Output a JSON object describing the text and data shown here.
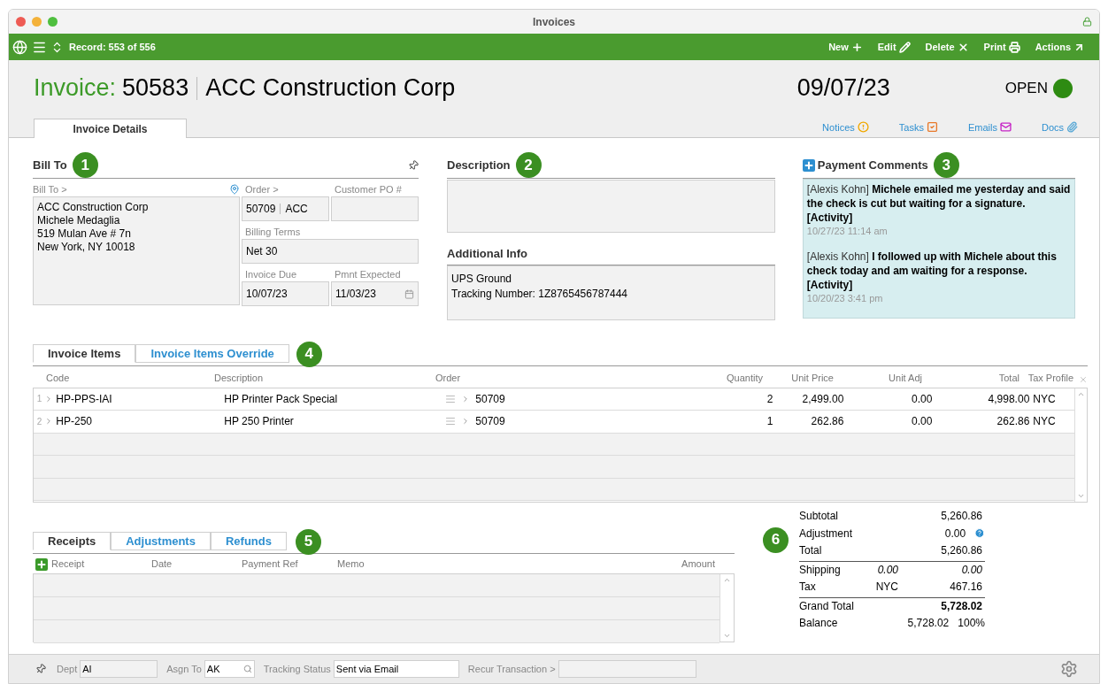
{
  "window": {
    "title": "Invoices"
  },
  "toolbar": {
    "record": "Record: 553 of 556",
    "actions": [
      {
        "label": "New",
        "kind": "plus"
      },
      {
        "label": "Edit",
        "kind": "pencil"
      },
      {
        "label": "Delete",
        "kind": "x"
      },
      {
        "label": "Print",
        "kind": "print"
      },
      {
        "label": "Actions",
        "kind": "arrow"
      }
    ]
  },
  "header": {
    "label": "Invoice:",
    "number": "50583",
    "customer": "ACC Construction Corp",
    "date": "09/07/23",
    "status": "OPEN"
  },
  "tabs": [
    {
      "label": "Invoice Details",
      "selected": true
    }
  ],
  "links": [
    {
      "label": "Notices",
      "kind": "notice"
    },
    {
      "label": "Tasks",
      "kind": "task"
    },
    {
      "label": "Emails",
      "kind": "email"
    },
    {
      "label": "Docs",
      "kind": "doc"
    }
  ],
  "bill_to": {
    "title": "Bill To",
    "callout": "1",
    "address_label": "Bill To >",
    "address_lines": [
      "ACC Construction Corp",
      "Michele Medaglia",
      "519 Mulan Ave # 7n",
      "New York, NY 10018"
    ],
    "order_label": "Order >",
    "order": "50709",
    "order_code": "ACC",
    "po_label": "Customer PO #",
    "terms_label": "Billing Terms",
    "terms": "Net 30",
    "due_label": "Invoice Due",
    "due": "10/07/23",
    "expected_label": "Pmnt Expected",
    "expected": "11/03/23"
  },
  "description": {
    "title": "Description",
    "callout": "2"
  },
  "additional_info": {
    "title": "Additional Info",
    "lines": [
      "UPS Ground",
      "Tracking Number: 1Z8765456787444"
    ]
  },
  "payment_comments": {
    "title": "Payment Comments",
    "callout": "3",
    "comments": [
      {
        "author": "[Alexis Kohn]",
        "text": "Michele emailed me yesterday and said the check is cut but waiting for a signature. [Activity]",
        "time": "10/27/23  11:14 am"
      },
      {
        "author": "[Alexis Kohn]",
        "text": "I followed up with Michele about this check today and am waiting for a response. [Activity]",
        "time": "10/20/23  3:41 pm"
      }
    ]
  },
  "items": {
    "tabs": [
      {
        "label": "Invoice Items",
        "selected": true
      },
      {
        "label": "Invoice Items Override",
        "selected": false
      }
    ],
    "callout": "4",
    "columns": [
      "Code",
      "Description",
      "Order",
      "Quantity",
      "Unit Price",
      "Unit Adj",
      "Total",
      "Tax Profile"
    ],
    "rows": [
      {
        "num": "1",
        "code": "HP-PPS-IAI",
        "description": "HP Printer Pack Special",
        "order": "50709",
        "quantity": "2",
        "unit_price": "2,499.00",
        "unit_adj": "0.00",
        "total": "4,998.00",
        "tax_profile": "NYC"
      },
      {
        "num": "2",
        "code": "HP-250",
        "description": "HP 250 Printer",
        "order": "50709",
        "quantity": "1",
        "unit_price": "262.86",
        "unit_adj": "0.00",
        "total": "262.86",
        "tax_profile": "NYC"
      }
    ]
  },
  "receipts": {
    "tabs": [
      {
        "label": "Receipts",
        "selected": true
      },
      {
        "label": "Adjustments",
        "selected": false
      },
      {
        "label": "Refunds",
        "selected": false
      }
    ],
    "callout": "5",
    "columns": [
      "Receipt",
      "Date",
      "Payment Ref",
      "Memo",
      "Amount"
    ]
  },
  "totals": {
    "callout": "6",
    "rows": [
      {
        "label": "Subtotal",
        "value": "5,260.86",
        "rule_above": false,
        "bold": false,
        "italic": false,
        "help": false
      },
      {
        "label": "Adjustment",
        "value": "0.00",
        "rule_above": false,
        "bold": false,
        "italic": false,
        "help": true
      },
      {
        "label": "Total",
        "value": "5,260.86",
        "rule_above": false,
        "bold": false,
        "italic": false,
        "help": false
      },
      {
        "label": "Shipping",
        "middle": "0.00",
        "value": "0.00",
        "rule_above": true,
        "bold": false,
        "italic": true,
        "help": false
      },
      {
        "label": "Tax",
        "middle": "NYC",
        "value": "467.16",
        "rule_above": false,
        "bold": false,
        "italic": false,
        "help": false
      },
      {
        "label": "Grand Total",
        "value": "5,728.02",
        "rule_above": true,
        "bold": true,
        "italic": false,
        "help": false
      },
      {
        "label": "Balance",
        "value": "5,728.02",
        "extra": "100%",
        "rule_above": false,
        "bold": false,
        "italic": false,
        "help": false
      }
    ]
  },
  "footer": {
    "fields": [
      {
        "label": "Dept",
        "value": "AI",
        "kind": "text"
      },
      {
        "label": "Asgn To",
        "value": "AK",
        "kind": "search"
      },
      {
        "label": "Tracking Status",
        "value": "Sent via Email",
        "kind": "text"
      },
      {
        "label": "Recur Transaction >",
        "kind": "text"
      }
    ]
  }
}
